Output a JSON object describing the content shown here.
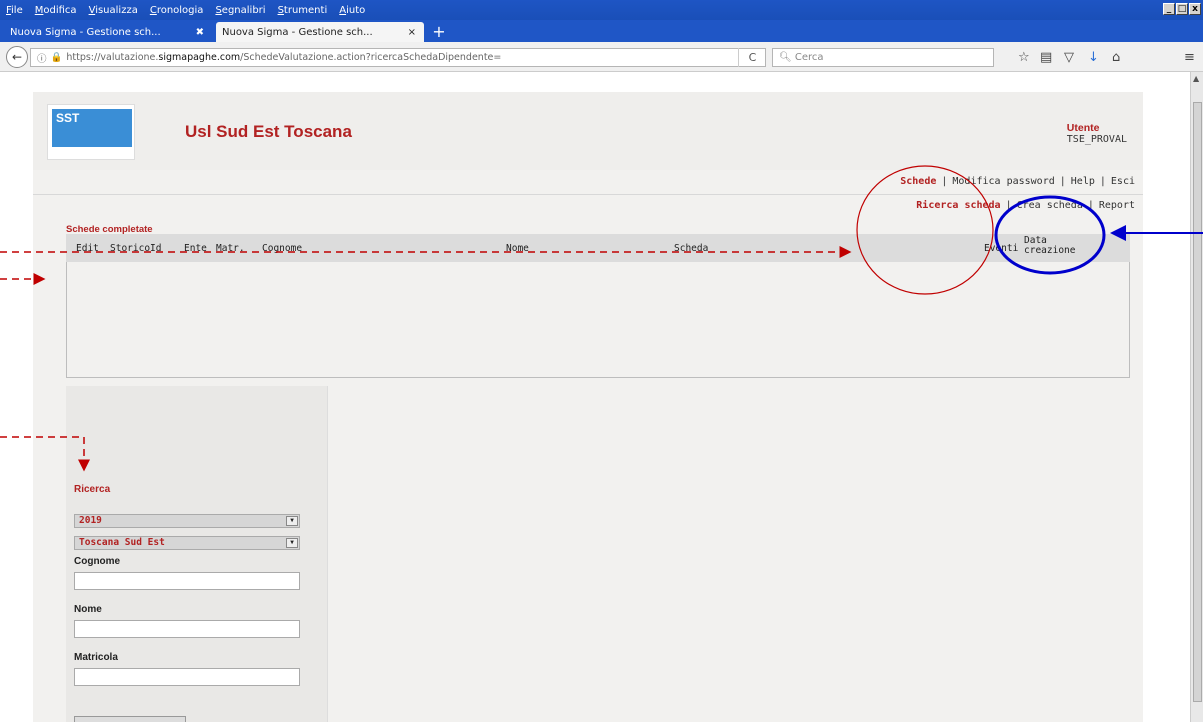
{
  "menu": [
    "File",
    "Modifica",
    "Visualizza",
    "Cronologia",
    "Segnalibri",
    "Strumenti",
    "Aiuto"
  ],
  "window_buttons": [
    "_",
    "□",
    "x"
  ],
  "tabs": [
    {
      "title": "Nuova Sigma - Gestione sch...",
      "close": "✖",
      "active": false
    },
    {
      "title": "Nuova Sigma - Gestione sch...",
      "close": "×",
      "active": true
    }
  ],
  "new_tab": "+",
  "url": {
    "prefix": "https://valutazione.",
    "domain": "sigmapaghe.com",
    "path": "/SchedeValutazione.action?ricercaSchedaDipendente="
  },
  "search_placeholder": "Cerca",
  "app": {
    "logo_text": "SST",
    "title": "Usl Sud Est Toscana",
    "user_label": "Utente",
    "user_name": "TSE_PROVAL"
  },
  "topnav": [
    "Schede",
    "Modifica password",
    "Help",
    "Esci"
  ],
  "subnav": [
    "Ricerca scheda",
    "Crea scheda",
    "Report"
  ],
  "section_title": "Schede completate",
  "columns": [
    "Edit",
    "StoricoId",
    "Ente",
    "Matr.",
    "Cognome",
    "Nome",
    "Scheda",
    "Eventi",
    "Data creazione"
  ],
  "search": {
    "title": "Ricerca",
    "year": "2019",
    "ente": "Toscana Sud Est",
    "fields": [
      "Cognome",
      "Nome",
      "Matricola"
    ]
  },
  "colors": {
    "accent_red": "#b22222",
    "annotation_red": "#c00000",
    "annotation_blue": "#0000cc",
    "titlebar_blue": "#1e55c4"
  }
}
